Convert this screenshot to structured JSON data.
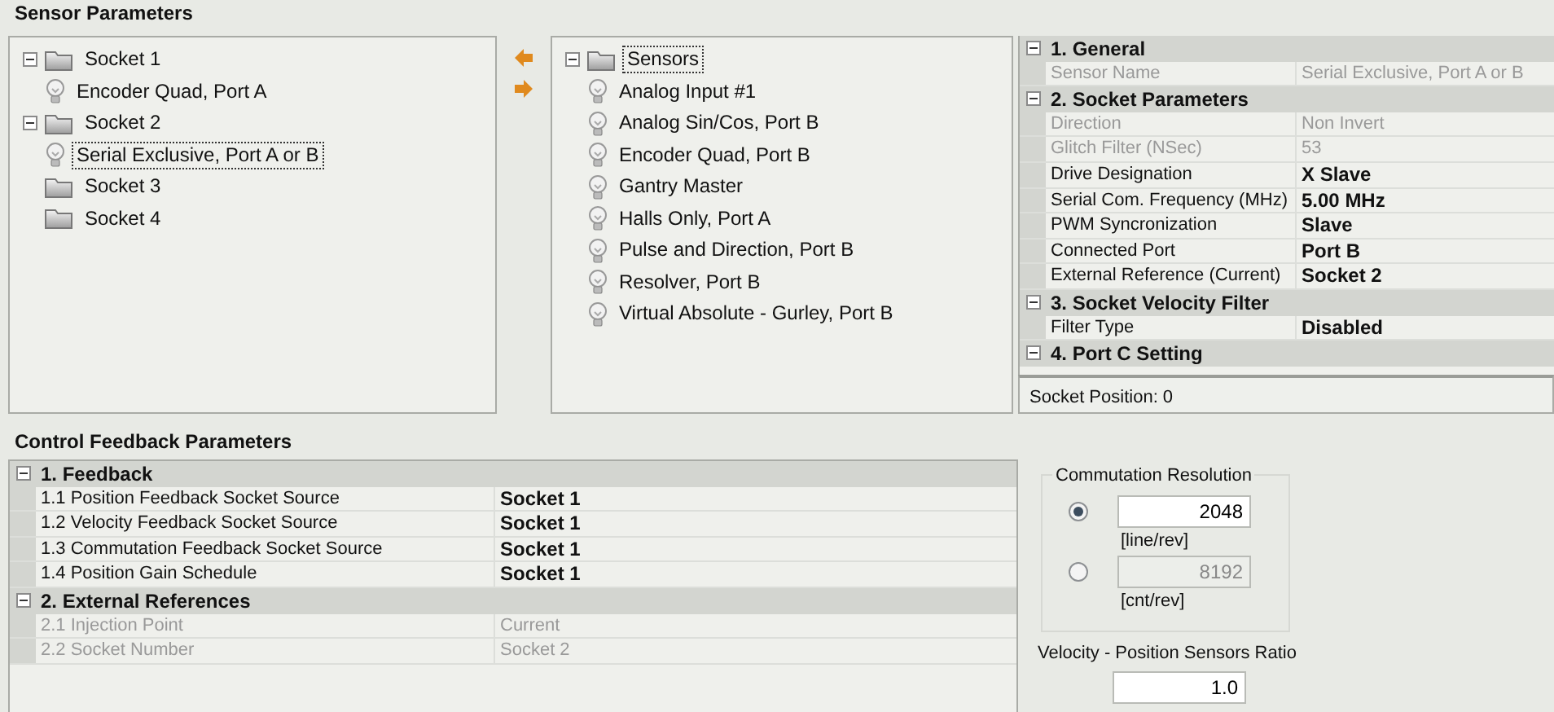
{
  "sensor_parameters": {
    "title": "Sensor Parameters",
    "socket_tree": [
      {
        "label": "Socket 1",
        "kind": "folder",
        "expanded": true,
        "selected": false,
        "children": [
          {
            "label": "Encoder Quad, Port A",
            "kind": "sensor",
            "selected": false
          }
        ]
      },
      {
        "label": "Socket 2",
        "kind": "folder",
        "expanded": true,
        "selected": false,
        "children": [
          {
            "label": "Serial Exclusive, Port A or B",
            "kind": "sensor",
            "selected": true
          }
        ]
      },
      {
        "label": "Socket 3",
        "kind": "folder",
        "selected": false
      },
      {
        "label": "Socket 4",
        "kind": "folder",
        "selected": false
      }
    ],
    "sensor_tree": [
      {
        "label": "Sensors",
        "kind": "folder",
        "expanded": true,
        "selected": true,
        "children": [
          {
            "label": "Analog Input #1",
            "kind": "sensor",
            "selected": false
          },
          {
            "label": "Analog Sin/Cos, Port B",
            "kind": "sensor",
            "selected": false
          },
          {
            "label": "Encoder Quad, Port B",
            "kind": "sensor",
            "selected": false
          },
          {
            "label": "Gantry Master",
            "kind": "sensor",
            "selected": false
          },
          {
            "label": "Halls Only, Port A",
            "kind": "sensor",
            "selected": false
          },
          {
            "label": "Pulse and Direction, Port B",
            "kind": "sensor",
            "selected": false
          },
          {
            "label": "Resolver, Port B",
            "kind": "sensor",
            "selected": false
          },
          {
            "label": "Virtual Absolute - Gurley, Port B",
            "kind": "sensor",
            "selected": false
          }
        ]
      }
    ],
    "properties": [
      {
        "label": "1. General",
        "expanded": true,
        "items": [
          {
            "name": "Sensor Name",
            "value": "Serial Exclusive, Port A or B",
            "disabled": true
          }
        ]
      },
      {
        "label": "2. Socket Parameters",
        "expanded": true,
        "items": [
          {
            "name": "Direction",
            "value": "Non Invert",
            "disabled": true
          },
          {
            "name": "Glitch Filter (NSec)",
            "value": "53",
            "disabled": true
          },
          {
            "name": "Drive Designation",
            "value": "X Slave",
            "disabled": false
          },
          {
            "name": "Serial Com. Frequency (MHz)",
            "value": "5.00 MHz",
            "disabled": false
          },
          {
            "name": "PWM Syncronization",
            "value": "Slave",
            "disabled": false
          },
          {
            "name": "Connected Port",
            "value": "Port B",
            "disabled": false
          },
          {
            "name": "External Reference (Current)",
            "value": "Socket 2",
            "disabled": false
          }
        ]
      },
      {
        "label": "3. Socket Velocity Filter",
        "expanded": true,
        "items": [
          {
            "name": "Filter Type",
            "value": "Disabled",
            "disabled": false
          }
        ]
      },
      {
        "label": "4. Port C Setting",
        "expanded": true
      }
    ],
    "socket_position": "Socket Position:  0"
  },
  "control_feedback": {
    "title": "Control Feedback  Parameters",
    "properties": [
      {
        "label": "1. Feedback",
        "expanded": true,
        "items": [
          {
            "name": "1.1 Position Feedback Socket Source",
            "value": "Socket 1",
            "disabled": false
          },
          {
            "name": "1.2 Velocity Feedback Socket Source",
            "value": "Socket 1",
            "disabled": false
          },
          {
            "name": "1.3 Commutation Feedback Socket Source",
            "value": "Socket 1",
            "disabled": false
          },
          {
            "name": "1.4 Position Gain Schedule",
            "value": "Socket 1",
            "disabled": false
          }
        ]
      },
      {
        "label": "2. External References",
        "expanded": true,
        "items": [
          {
            "name": "2.1 Injection Point",
            "value": "Current",
            "disabled": true
          },
          {
            "name": "2.2 Socket Number",
            "value": "Socket 2",
            "disabled": true
          }
        ]
      }
    ],
    "commutation_resolution": {
      "title": "Commutation Resolution",
      "options": [
        {
          "value": "2048",
          "unit": "[line/rev]",
          "selected": true
        },
        {
          "value": "8192",
          "unit": "[cnt/rev]",
          "selected": false
        }
      ]
    },
    "ratio": {
      "label": "Velocity - Position Sensors Ratio",
      "value": "1.0"
    }
  }
}
